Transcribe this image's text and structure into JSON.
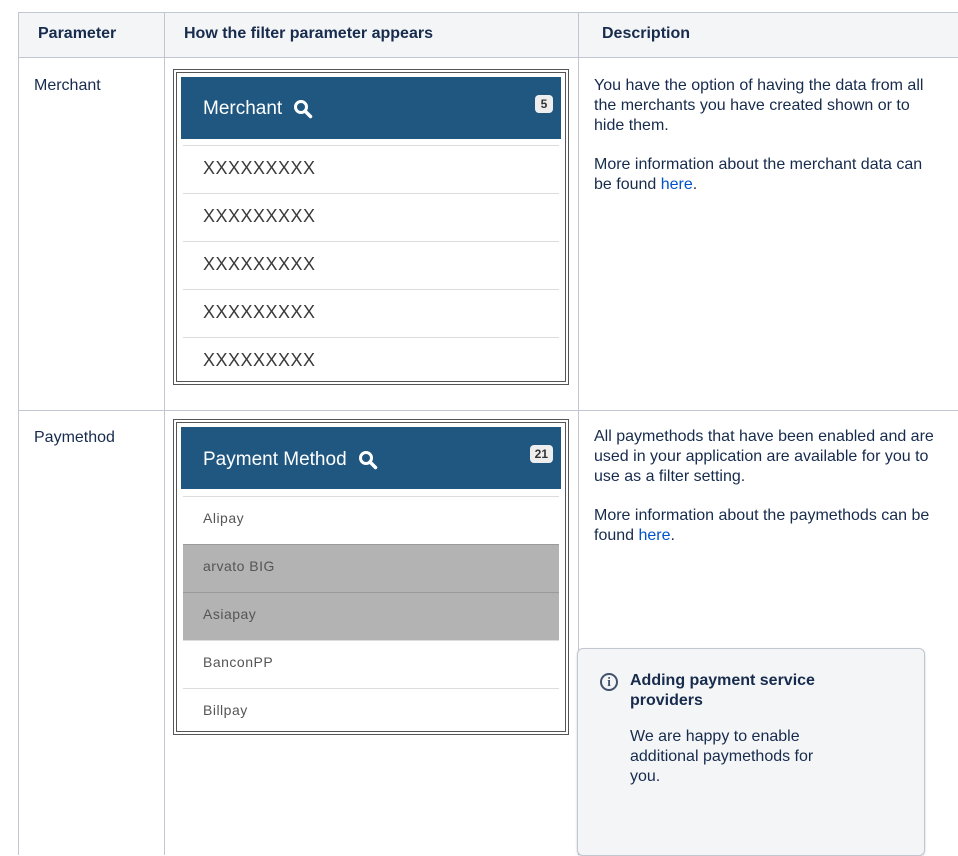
{
  "table": {
    "headers": [
      "Parameter",
      "How the filter parameter appears",
      "Description"
    ],
    "rows": [
      {
        "parameter": "Merchant",
        "widget": {
          "title": "Merchant",
          "icon": "search-icon",
          "badge": "5",
          "items": [
            "XXXXXXXXX",
            "XXXXXXXXX",
            "XXXXXXXXX",
            "XXXXXXXXX",
            "XXXXXXXXX"
          ]
        },
        "description": {
          "p1": "You have the option of having the data from all the merchants you have created shown or to hide them.",
          "p2_prefix": "More information about the merchant data can be found ",
          "p2_link": "here",
          "p2_suffix": "."
        }
      },
      {
        "parameter": "Paymethod",
        "widget": {
          "title": "Payment Method",
          "icon": "search-icon",
          "badge": "21",
          "items": [
            "Alipay",
            "arvato BIG",
            "Asiapay",
            "BanconPP",
            "Billpay"
          ],
          "selected": [
            "arvato BIG",
            "Asiapay"
          ]
        },
        "description": {
          "p1": "All paymethods that have been enabled and are used in your application are available for you to use as a filter setting.",
          "p2_prefix": "More information about the paymethods can be found ",
          "p2_link": "here",
          "p2_suffix": "."
        },
        "info_panel": {
          "icon": "info-icon",
          "title": "Adding payment service providers",
          "body": "We are happy to enable additional paymethods for you."
        }
      }
    ]
  },
  "colors": {
    "widget_header": "#1f5780",
    "selected_row": "#b3b3b3",
    "link": "#0052cc",
    "table_header_bg": "#f4f5f7"
  }
}
